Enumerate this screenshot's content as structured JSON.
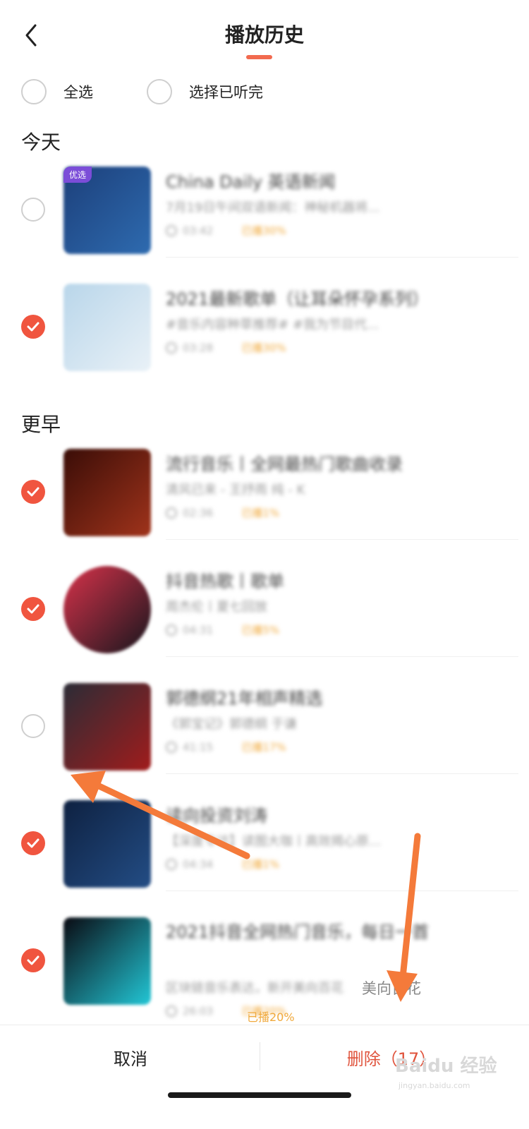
{
  "header": {
    "title": "播放历史",
    "back_icon": "chevron-left-icon"
  },
  "select": {
    "all_label": "全选",
    "finished_label": "选择已听完"
  },
  "sections": {
    "today": "今天",
    "earlier": "更早"
  },
  "items": [
    {
      "title": "China Daily 英语新闻",
      "subtitle": "7月19日午间双语新闻：神秘机器将...",
      "duration": "03:42",
      "played": "已播30%",
      "checked": false,
      "badge": "优选",
      "cover_colors": [
        "#1c3f7a",
        "#2e6bb0"
      ]
    },
    {
      "title": "2021最新歌单（让耳朵怀孕系列）",
      "subtitle": "#音乐内容种草推荐# #我为节目代...",
      "duration": "03:28",
      "played": "已播30%",
      "checked": true,
      "cover_colors": [
        "#b9d6ea",
        "#e9f1f7"
      ]
    },
    {
      "title": "流行音乐丨全网最热门歌曲收录",
      "subtitle": "清风已来 - 王抒雨 纯 - K",
      "duration": "02:36",
      "played": "已播1%",
      "checked": true,
      "cover_colors": [
        "#3a0d07",
        "#a0331b"
      ]
    },
    {
      "title": "抖音热歌丨歌单",
      "subtitle": "周杰伦丨夏七回放",
      "duration": "04:31",
      "played": "已播5%",
      "checked": true,
      "cover_colors": [
        "#d8324a",
        "#16161d"
      ]
    },
    {
      "title": "郭德纲21年相声精选",
      "subtitle": "《郭宝记》郭德纲 于谦",
      "duration": "41:15",
      "played": "已播17%",
      "checked": false,
      "cover_colors": [
        "#2b2c36",
        "#a11c1c"
      ]
    },
    {
      "title": "读向投资刘涛",
      "subtitle": "【深度专访】读图大咖丨高效揭心原...",
      "duration": "04:34",
      "played": "已播1%",
      "checked": true,
      "cover_colors": [
        "#0e2141",
        "#234d85"
      ]
    },
    {
      "title": "2021抖音全网热门音乐，每日一首",
      "subtitle": "区块链音乐表达，新开美向百花",
      "duration": "26:03",
      "played": "已播20%",
      "checked": true,
      "cover_colors": [
        "#0a0a12",
        "#22c7d6"
      ]
    }
  ],
  "overlay": {
    "text": "美向百花",
    "played": "已播20%"
  },
  "bottom": {
    "cancel_label": "取消",
    "delete_label": "删除（17）"
  },
  "watermark": {
    "brand": "Baidu 经验",
    "url": "jingyan.baidu.com"
  },
  "colors": {
    "accent": "#f0553f",
    "played": "#f0a93c",
    "arrow": "#f47a3a"
  }
}
